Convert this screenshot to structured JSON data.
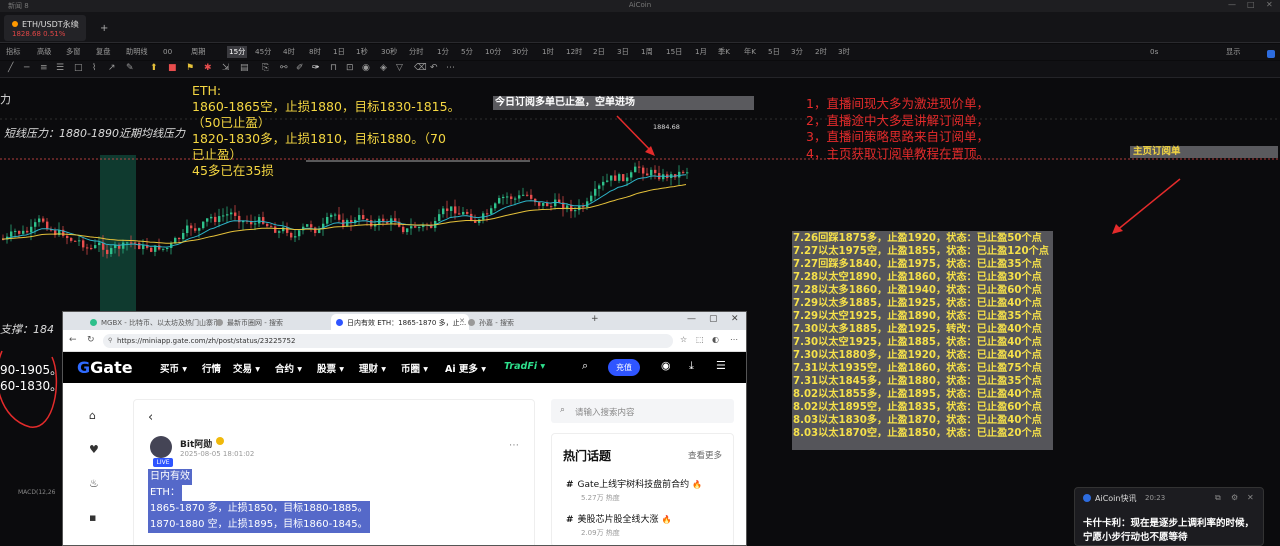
{
  "window": {
    "title": "AiCoin",
    "left_label": "新闻 8",
    "controls": [
      "—",
      "□",
      "✕"
    ]
  },
  "tab": {
    "name": "ETH/USDT永续",
    "price_change": "1828.68 0.51%",
    "close": "×",
    "add": "+"
  },
  "toolbar": {
    "items": [
      "指标",
      "高级",
      "多窗",
      "复盘",
      "助明线",
      "00"
    ],
    "intervals": [
      "周期",
      "15分",
      "45分",
      "4时",
      "8时",
      "1日",
      "1秒",
      "30秒",
      "分时",
      "1分",
      "5分",
      "10分",
      "30分",
      "1时",
      "12时",
      "2日",
      "3日",
      "1周",
      "15日",
      "1月",
      "季K",
      "年K",
      "5日",
      "3分",
      "2时",
      "3时"
    ],
    "active_interval": "15分",
    "right": [
      "0s",
      "显示"
    ]
  },
  "annotations": {
    "eth_lines": [
      "ETH:",
      "1860-1865空，止损1880，目标1830-1815。",
      "（50已止盈）",
      "1820-1830多，止损1810，目标1880。（70",
      "已止盈）",
      "45多已在35损"
    ],
    "banner_top": "今日订阅多单已止盈，空单进场",
    "price_label": "1884.68",
    "red_notes": [
      "1，直播间现大多为激进现价单，",
      "2，直播途中大多是讲解订阅单，",
      "3，直播间策略思路来自订阅单，",
      "4，主页获取订阅单教程在置顶。"
    ],
    "banner_right": "主页订阅单",
    "short_resistance": "短线压力：1880-1890近期均线压力",
    "support": "支撑：184",
    "left_prices": [
      "90-1905。",
      "60-1830。"
    ],
    "macd": "MACD(12,26",
    "left_edge": "力"
  },
  "records": [
    "7.26回踩1875多，止盈1920，状态：已止盈50个点",
    "7.27以太1975空，止盈1855，状态：已止盈120个点",
    "7.27回踩多1840，止盈1975，状态：已止盈35个点",
    "7.28以太空1890，止盈1860，状态：已止盈30个点",
    "7.28以太多1860，止盈1940，状态：已止盈60个点",
    "7.29以太多1885，止盈1925，状态：已止盈40个点",
    "7.29以太空1925，止盈1890，状态：已止盈35个点",
    "7.30以太多1885，止盈1925，转改：已止盈40个点",
    "7.30以太空1925，止盈1885，状态：已止盈40个点",
    "7.30以太1880多，止盈1920，状态：已止盈40个点",
    "7.31以太1935空，止盈1860，状态：已止盈75个点",
    "7.31以太1845多，止盈1880，状态：已止盈35个点",
    "8.02以太1855多，止盈1895，状态：已止盈40个点",
    "8.02以太1895空，止盈1835，状态：已止盈60个点",
    "8.03以太1830多，止盈1870，状态：已止盈40个点",
    "8.03以太1870空，止盈1850，状态：已止盈20个点"
  ],
  "browser": {
    "tabs": [
      "MGBX - 比特币、以太坊及热门山寨币",
      "最新币圈网 - 搜索",
      "日内有效 ETH：1865-1870 多，止...",
      "孙嘉 - 搜索"
    ],
    "active_tab": 2,
    "url": "https://miniapp.gate.com/zh/post/status/23225752",
    "nav": {
      "logo": "Gate",
      "items": [
        "买币 ▾",
        "行情",
        "交易 ▾",
        "合约 ▾",
        "股票 ▾",
        "理财 ▾",
        "币圈 ▾",
        "Ai 更多 ▾",
        "TradFi ▾"
      ],
      "deposit": "充值"
    },
    "post": {
      "author": "Bit阿勋",
      "time": "2025-08-05 18:01:02",
      "badge": "LIVE",
      "lines": [
        "日内有效",
        "ETH：",
        "1865-1870 多，止损1850，目标1880-1885。",
        "1870-1880 空，止损1895，目标1860-1845。"
      ]
    },
    "search_placeholder": "请输入搜索内容",
    "hot": {
      "title": "热门话题",
      "more": "查看更多",
      "topics": [
        {
          "name": "Gate上线宇树科技盘前合约",
          "heat": "5.27万 热度"
        },
        {
          "name": "美股芯片股全线大涨",
          "heat": "2.09万 热度"
        }
      ]
    }
  },
  "notification": {
    "source": "AiCoin快讯",
    "time": "20:23",
    "body": [
      "卡什卡利：现在是逐步上调利率的时候，",
      "宁愿小步行动也不愿等待"
    ]
  },
  "colors": {
    "up": "#e84d4d",
    "down": "#2ec08b",
    "ma_fast": "#2db4c8",
    "ma_slow": "#e6c23a",
    "highlight": "#5569c9"
  }
}
